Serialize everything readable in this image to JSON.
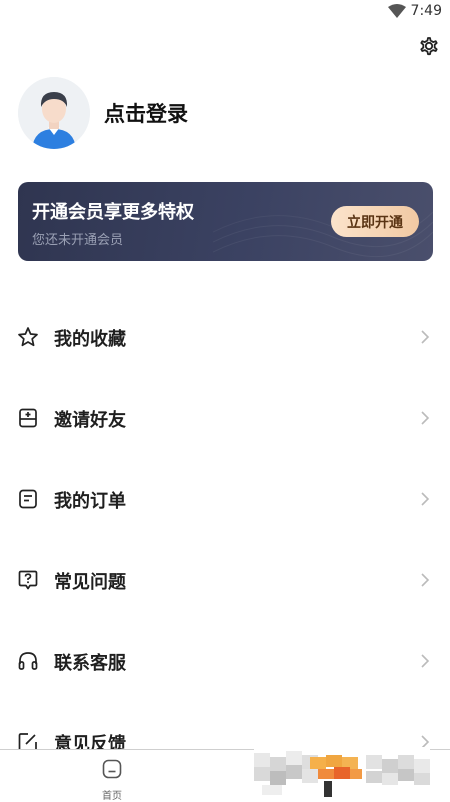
{
  "status_bar": {
    "time": "7:49"
  },
  "profile": {
    "login_label": "点击登录"
  },
  "vip": {
    "title": "开通会员享更多特权",
    "subtitle": "您还未开通会员",
    "button_label": "立即开通"
  },
  "menu": {
    "items": [
      {
        "label": "我的收藏",
        "icon": "star-icon"
      },
      {
        "label": "邀请好友",
        "icon": "invite-icon"
      },
      {
        "label": "我的订单",
        "icon": "order-icon"
      },
      {
        "label": "常见问题",
        "icon": "question-icon"
      },
      {
        "label": "联系客服",
        "icon": "headset-icon"
      },
      {
        "label": "意见反馈",
        "icon": "feedback-icon"
      }
    ]
  },
  "tabbar": {
    "home_label": "首页"
  },
  "colors": {
    "vip_card": "#363c58",
    "vip_button": "#f6d5b5",
    "text_primary": "#1a1a1a"
  }
}
